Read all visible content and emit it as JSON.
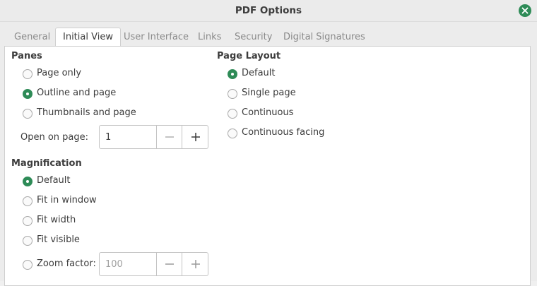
{
  "window": {
    "title": "PDF Options"
  },
  "icons": {
    "close": "close-icon",
    "minus": "minus-icon",
    "plus": "plus-icon"
  },
  "colors": {
    "accent": "#2e8b57"
  },
  "tabs": [
    {
      "label": "General",
      "active": false
    },
    {
      "label": "Initial View",
      "active": true
    },
    {
      "label": "User Interface",
      "active": false
    },
    {
      "label": "Links",
      "active": false
    },
    {
      "label": "Security",
      "active": false
    },
    {
      "label": "Digital Signatures",
      "active": false
    }
  ],
  "panes": {
    "title": "Panes",
    "options": [
      {
        "label": "Page only",
        "checked": false
      },
      {
        "label": "Outline and page",
        "checked": true
      },
      {
        "label": "Thumbnails and page",
        "checked": false
      }
    ],
    "open_on_page": {
      "label": "Open on page:",
      "value": "1"
    }
  },
  "page_layout": {
    "title": "Page Layout",
    "options": [
      {
        "label": "Default",
        "checked": true
      },
      {
        "label": "Single page",
        "checked": false
      },
      {
        "label": "Continuous",
        "checked": false
      },
      {
        "label": "Continuous facing",
        "checked": false
      }
    ]
  },
  "magnification": {
    "title": "Magnification",
    "options": [
      {
        "label": "Default",
        "checked": true
      },
      {
        "label": "Fit in window",
        "checked": false
      },
      {
        "label": "Fit width",
        "checked": false
      },
      {
        "label": "Fit visible",
        "checked": false
      }
    ],
    "zoom_factor": {
      "label": "Zoom factor:",
      "value": "100",
      "enabled": false
    }
  }
}
